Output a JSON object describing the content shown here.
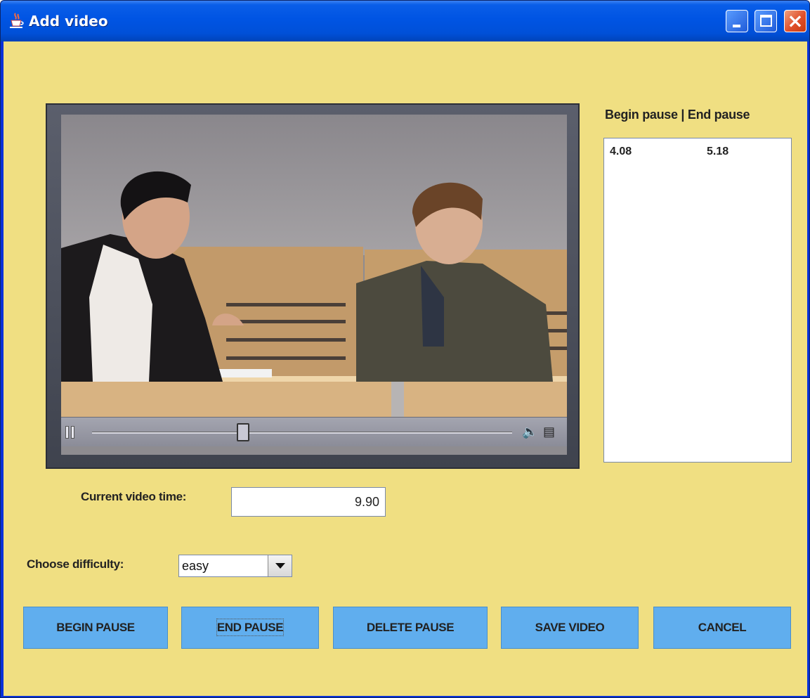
{
  "window": {
    "title": "Add video",
    "icon": "java-cup-icon"
  },
  "titlebar_buttons": {
    "minimize": "minimize-icon",
    "maximize": "maximize-icon",
    "close": "×"
  },
  "video": {
    "progress_fraction": 0.36,
    "pause_icon": "pause-icon",
    "volume_icon": "🔈",
    "film_icon": "▤"
  },
  "pauses": {
    "header": "Begin pause | End pause",
    "rows": [
      {
        "begin": "4.08",
        "end": "5.18"
      }
    ]
  },
  "time": {
    "label": "Current video time:",
    "value": "9.90"
  },
  "difficulty": {
    "label": "Choose difficulty:",
    "value": "easy"
  },
  "buttons": {
    "begin_pause": "BEGIN PAUSE",
    "end_pause": "END PAUSE",
    "delete_pause": "DELETE PAUSE",
    "save_video": "SAVE VIDEO",
    "cancel": "CANCEL"
  }
}
